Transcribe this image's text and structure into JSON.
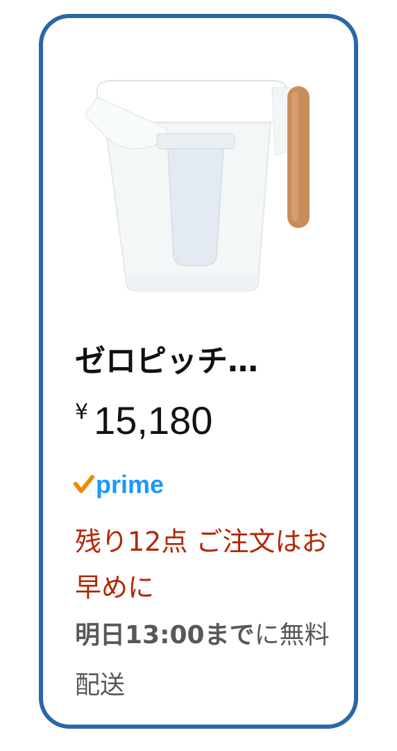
{
  "product": {
    "title": "ゼロピッチ…",
    "currency_symbol": "¥",
    "price": "15,180",
    "badge": {
      "icon": "prime-check-icon",
      "label": "prime",
      "color": "#1a98ff",
      "check_color": "#f08804"
    },
    "stock_message": "残り12点 ご注文はお早めに",
    "delivery": {
      "date": "明日13:00まで",
      "suffix": "に無料配送"
    }
  },
  "colors": {
    "card_border": "#2b66a8",
    "stock_text": "#b12704",
    "secondary_text": "#565959"
  }
}
